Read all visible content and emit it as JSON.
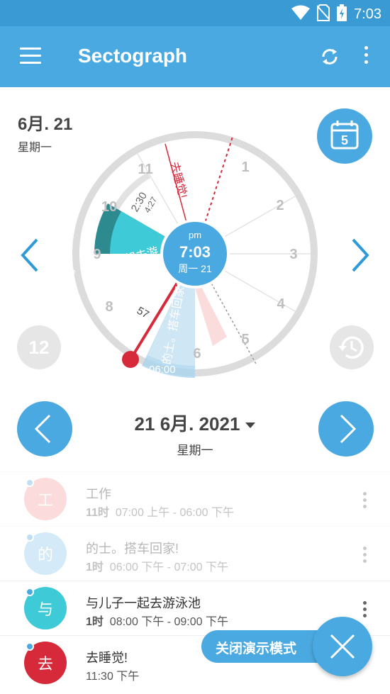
{
  "status_bar": {
    "time": "7:03"
  },
  "app_bar": {
    "title": "Sectograph"
  },
  "date_header": {
    "date": "6月. 21",
    "weekday": "星期一"
  },
  "calendar_button": {
    "day": "5"
  },
  "dial": {
    "hour_labels": [
      "11",
      "1",
      "10",
      "2",
      "3",
      "4",
      "5",
      "6",
      "8",
      "9"
    ],
    "center": {
      "ampm": "pm",
      "time": "7:03",
      "day": "周一 21"
    },
    "countdown": {
      "big": "2:30",
      "small": "4:27"
    },
    "minutes_label": "57",
    "sectors": {
      "sleep": "去睡觉!",
      "swim": "与儿子一起去游",
      "swim_minutes": "60",
      "swim_time": "08:00",
      "taxi": "的士。搭车回家!",
      "taxi_time": "06:00"
    },
    "colors": {
      "swim": "#3ecad6",
      "swim_dark": "#2d8a8e",
      "taxi": "#a9d5ef",
      "sleep": "#d62a3a",
      "accent": "#4aa9e0"
    }
  },
  "controls": {
    "twelve_label": "12"
  },
  "date_nav": {
    "date": "21 6月. 2021",
    "weekday": "星期一"
  },
  "events": [
    {
      "avatar": "工",
      "color": "#f49a9a",
      "title": "工作",
      "duration": "11时",
      "range": "07:00 上午  -  06:00 下午",
      "faded": true
    },
    {
      "avatar": "的",
      "color": "#86c4ec",
      "title": "的士。搭车回家!",
      "duration": "1时",
      "range": "06:00 下午  -  07:00 下午",
      "faded": true
    },
    {
      "avatar": "与",
      "color": "#3ecad6",
      "title": "与儿子一起去游泳池",
      "duration": "1时",
      "range": "08:00 下午  -  09:00 下午",
      "faded": false
    },
    {
      "avatar": "去",
      "color": "#d62a3a",
      "title": "去睡觉!",
      "duration": "",
      "range": "11:30 下午",
      "faded": false
    }
  ],
  "demo": {
    "label": "关闭演示模式"
  }
}
